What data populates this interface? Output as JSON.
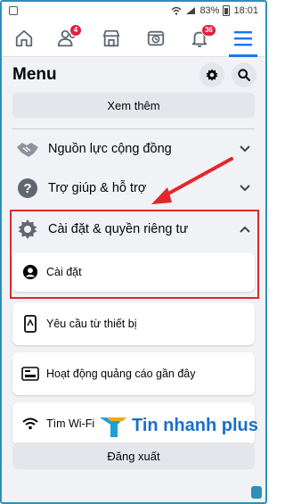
{
  "status_bar": {
    "battery_percent": "83%",
    "time": "18:01"
  },
  "nav": {
    "friends_badge": "4",
    "notifications_badge": "36"
  },
  "menu": {
    "title": "Menu"
  },
  "see_more_label": "Xem thêm",
  "sections": {
    "community": "Nguồn lực cộng đồng",
    "help": "Trợ giúp & hỗ trợ",
    "settings_privacy": "Cài đặt & quyền riêng tư"
  },
  "cards": {
    "settings": "Cài đặt",
    "device_requests": "Yêu cầu từ thiết bị",
    "ad_activity": "Hoạt động quảng cáo gần đây",
    "find_wifi": "Tìm Wi-Fi"
  },
  "logout_label": "Đăng xuất",
  "watermark": "Tin nhanh plus",
  "colors": {
    "accent": "#1877f2",
    "badge": "#e41e3f",
    "highlight": "#e3262b"
  }
}
